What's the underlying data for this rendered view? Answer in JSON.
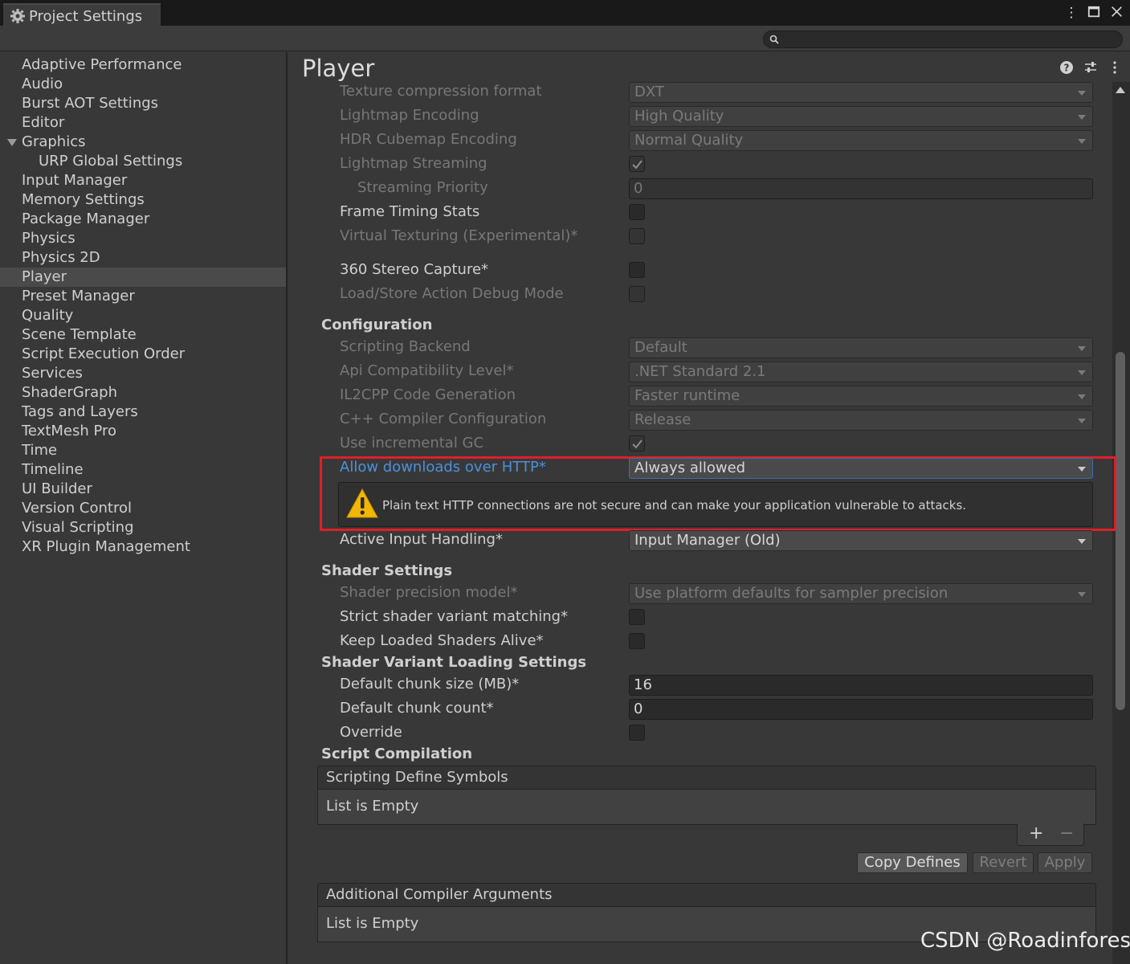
{
  "window": {
    "tab_title": "Project Settings"
  },
  "search": {
    "placeholder": ""
  },
  "sidebar": {
    "items": [
      {
        "label": "Adaptive Performance"
      },
      {
        "label": "Audio"
      },
      {
        "label": "Burst AOT Settings"
      },
      {
        "label": "Editor"
      },
      {
        "label": "Graphics"
      },
      {
        "label": "URP Global Settings"
      },
      {
        "label": "Input Manager"
      },
      {
        "label": "Memory Settings"
      },
      {
        "label": "Package Manager"
      },
      {
        "label": "Physics"
      },
      {
        "label": "Physics 2D"
      },
      {
        "label": "Player"
      },
      {
        "label": "Preset Manager"
      },
      {
        "label": "Quality"
      },
      {
        "label": "Scene Template"
      },
      {
        "label": "Script Execution Order"
      },
      {
        "label": "Services"
      },
      {
        "label": "ShaderGraph"
      },
      {
        "label": "Tags and Layers"
      },
      {
        "label": "TextMesh Pro"
      },
      {
        "label": "Time"
      },
      {
        "label": "Timeline"
      },
      {
        "label": "UI Builder"
      },
      {
        "label": "Version Control"
      },
      {
        "label": "Visual Scripting"
      },
      {
        "label": "XR Plugin Management"
      }
    ]
  },
  "main": {
    "title": "Player",
    "rows": {
      "texture_compression": {
        "label": "Texture compression format",
        "value": "DXT"
      },
      "lightmap_encoding": {
        "label": "Lightmap Encoding",
        "value": "High Quality"
      },
      "hdr_cubemap": {
        "label": "HDR Cubemap Encoding",
        "value": "Normal Quality"
      },
      "lightmap_streaming": {
        "label": "Lightmap Streaming",
        "checked": true
      },
      "streaming_priority": {
        "label": "Streaming Priority",
        "value": "0"
      },
      "frame_timing": {
        "label": "Frame Timing Stats",
        "checked": false
      },
      "virtual_texturing": {
        "label": "Virtual Texturing (Experimental)*",
        "checked": false
      },
      "stereo_capture": {
        "label": "360 Stereo Capture*",
        "checked": false
      },
      "load_store_debug": {
        "label": "Load/Store Action Debug Mode",
        "checked": false
      },
      "scripting_backend": {
        "label": "Scripting Backend",
        "value": "Default"
      },
      "api_compat": {
        "label": "Api Compatibility Level*",
        "value": ".NET Standard 2.1"
      },
      "il2cpp_codegen": {
        "label": "IL2CPP Code Generation",
        "value": "Faster runtime"
      },
      "cpp_compiler": {
        "label": "C++ Compiler Configuration",
        "value": "Release"
      },
      "incremental_gc": {
        "label": "Use incremental GC",
        "checked": true
      },
      "allow_http": {
        "label": "Allow downloads over HTTP*",
        "value": "Always allowed"
      },
      "active_input": {
        "label": "Active Input Handling*",
        "value": "Input Manager (Old)"
      },
      "shader_precision": {
        "label": "Shader precision model*",
        "value": "Use platform defaults for sampler precision"
      },
      "strict_variant": {
        "label": "Strict shader variant matching*",
        "checked": false
      },
      "keep_shaders": {
        "label": "Keep Loaded Shaders Alive*",
        "checked": false
      },
      "chunk_size": {
        "label": "Default chunk size (MB)*",
        "value": "16"
      },
      "chunk_count": {
        "label": "Default chunk count*",
        "value": "0"
      },
      "override": {
        "label": "Override",
        "checked": false
      }
    },
    "sections": {
      "configuration": "Configuration",
      "shader_settings": "Shader Settings",
      "shader_variant_loading": "Shader Variant Loading Settings",
      "script_compilation": "Script Compilation"
    },
    "http_warning": "Plain text HTTP connections are not secure and can make your application vulnerable to attacks.",
    "define_symbols": {
      "header": "Scripting Define Symbols",
      "empty": "List is Empty"
    },
    "list_controls": {
      "add": "+",
      "remove": "−"
    },
    "buttons": {
      "copy_defines": "Copy Defines",
      "revert": "Revert",
      "apply": "Apply"
    },
    "compiler_args": {
      "header": "Additional Compiler Arguments",
      "empty": "List is Empty"
    }
  },
  "watermark": "CSDN @Roadinforest"
}
